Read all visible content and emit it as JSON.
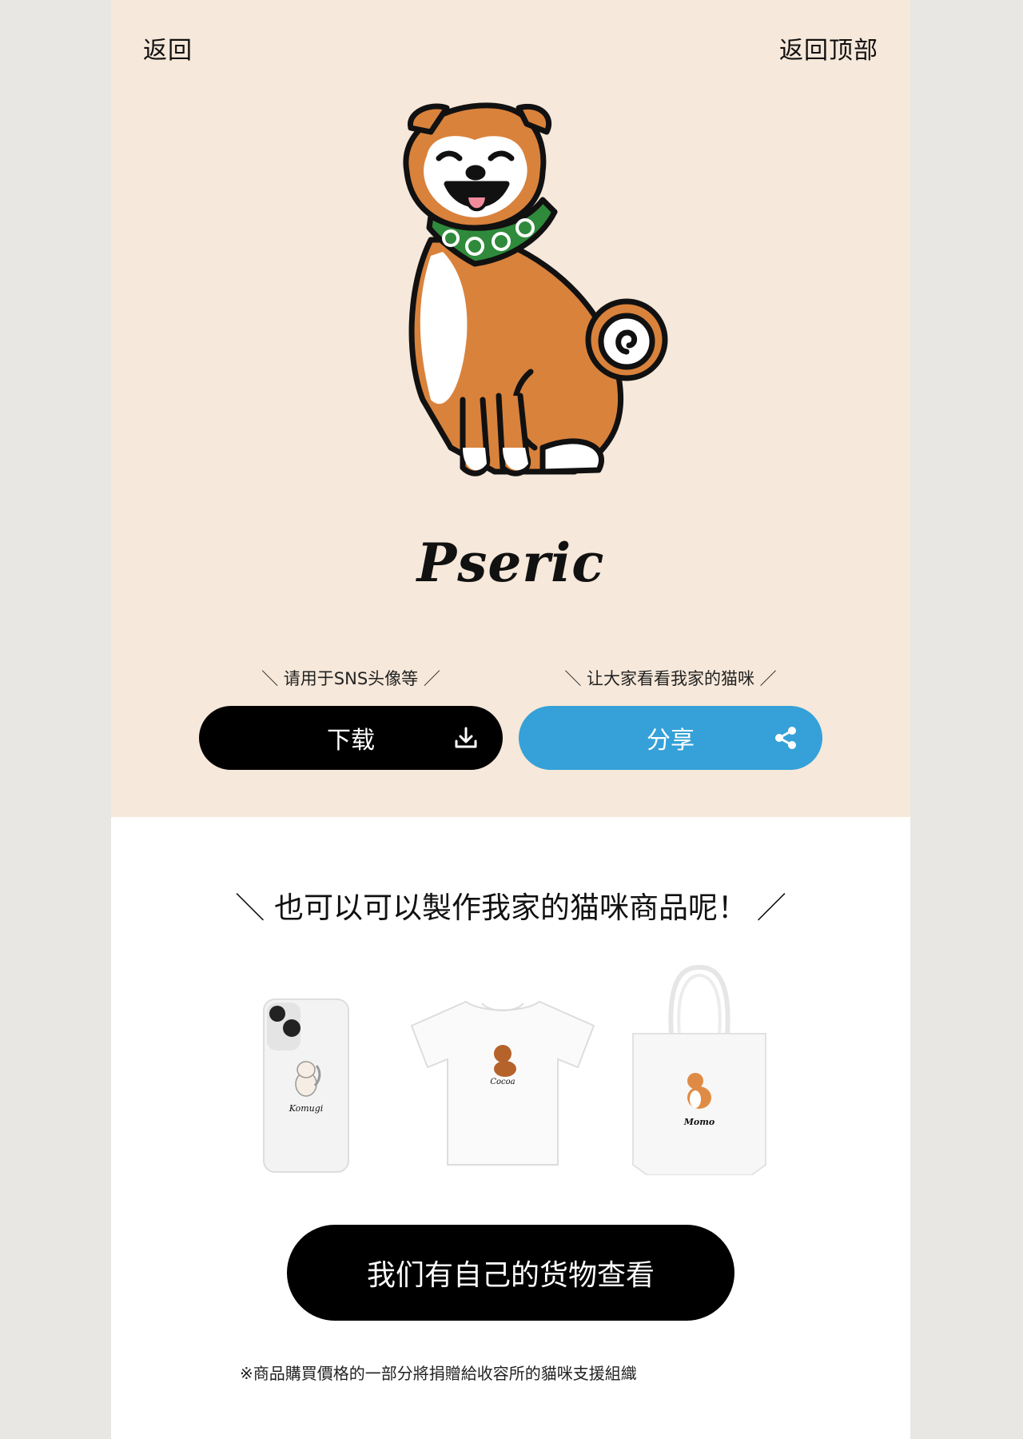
{
  "nav": {
    "back_label": "返回",
    "top_label": "返回顶部"
  },
  "hero": {
    "pet_name": "Pseric",
    "download_caption": "＼ 请用于SNS头像等 ／",
    "share_caption": "＼ 让大家看看我家的猫咪 ／",
    "download_label": "下载",
    "share_label": "分享",
    "colors": {
      "background": "#f6e8da",
      "download_button": "#000000",
      "share_button": "#35a1d8"
    }
  },
  "products": {
    "heading": "＼ 也可以可以製作我家的猫咪商品呢！ ／",
    "items": [
      {
        "type": "phone-case",
        "pet_label": "Komugi"
      },
      {
        "type": "t-shirt",
        "pet_label": "Cocoa"
      },
      {
        "type": "tote-bag",
        "pet_label": "Momo"
      }
    ],
    "cta_label": "我们有自己的货物查看",
    "footnote": "※商品購買價格的一部分將捐贈給收容所的貓咪支援組織"
  }
}
